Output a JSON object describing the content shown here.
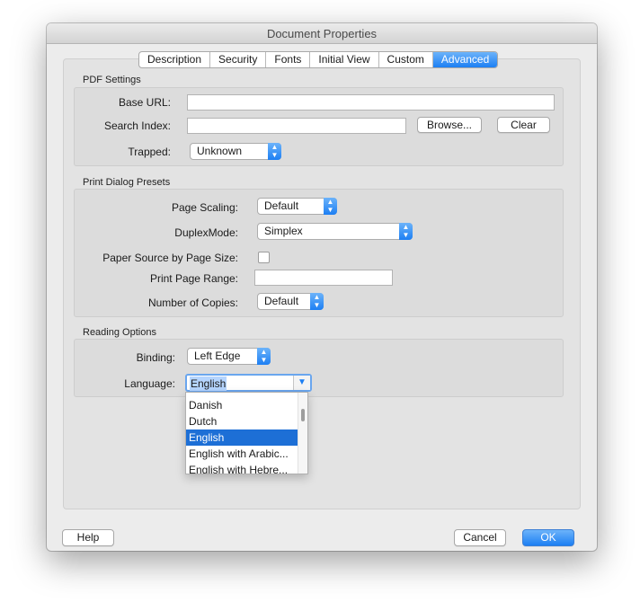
{
  "window": {
    "title": "Document Properties"
  },
  "tabs": [
    "Description",
    "Security",
    "Fonts",
    "Initial View",
    "Custom",
    "Advanced"
  ],
  "active_tab": "Advanced",
  "pdf_settings": {
    "title": "PDF Settings",
    "base_url_label": "Base URL:",
    "base_url_value": "",
    "search_index_label": "Search Index:",
    "search_index_value": "",
    "browse_label": "Browse...",
    "clear_label": "Clear",
    "trapped_label": "Trapped:",
    "trapped_value": "Unknown"
  },
  "print_presets": {
    "title": "Print Dialog Presets",
    "page_scaling_label": "Page Scaling:",
    "page_scaling_value": "Default",
    "duplex_label": "DuplexMode:",
    "duplex_value": "Simplex",
    "paper_source_label": "Paper Source by Page Size:",
    "paper_source_checked": false,
    "print_range_label": "Print Page Range:",
    "print_range_value": "",
    "copies_label": "Number of Copies:",
    "copies_value": "Default"
  },
  "reading": {
    "title": "Reading Options",
    "binding_label": "Binding:",
    "binding_value": "Left Edge",
    "language_label": "Language:",
    "language_value": "English",
    "language_options": [
      "Danish",
      "Dutch",
      "English",
      "English with Arabic...",
      "English with Hebre..."
    ],
    "language_selected": "English"
  },
  "footer": {
    "help_label": "Help",
    "cancel_label": "Cancel",
    "ok_label": "OK"
  },
  "colors": {
    "accent": "#1d7ff3",
    "selection": "#1d6fd6"
  },
  "icons": {
    "popup_arrows": "updown-chevron-icon",
    "combo_arrow": "chevron-down-icon"
  }
}
